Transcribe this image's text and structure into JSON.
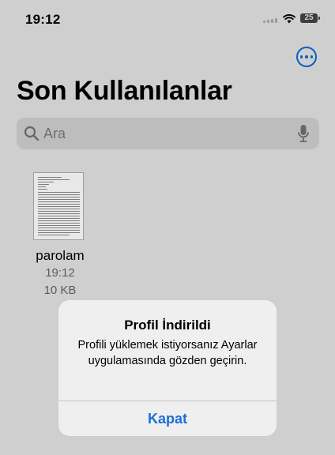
{
  "status_bar": {
    "time": "19:12",
    "battery_level": "25",
    "signal_icon": "cellular-signal-icon",
    "wifi_icon": "wifi-icon",
    "battery_icon": "battery-icon"
  },
  "header": {
    "more_icon": "ellipsis-circle-icon",
    "title": "Son Kullanılanlar"
  },
  "search": {
    "placeholder": "Ara",
    "value": "",
    "search_icon": "magnifying-glass-icon",
    "mic_icon": "microphone-icon"
  },
  "files": [
    {
      "name": "parolam",
      "time": "19:12",
      "size": "10 KB"
    }
  ],
  "alert": {
    "title": "Profil İndirildi",
    "message": "Profili yüklemek istiyorsanız Ayarlar uygulamasında gözden geçirin.",
    "button_label": "Kapat"
  },
  "colors": {
    "background": "#cfcfcf",
    "accent": "#0a5fc2",
    "alert_background": "#efefef",
    "alert_button": "#1d6fd6"
  }
}
